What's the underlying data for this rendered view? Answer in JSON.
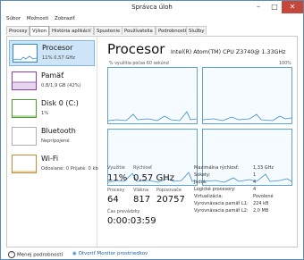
{
  "window": {
    "title": "Správca úloh"
  },
  "menu": [
    "Súbor",
    "Možnosti",
    "Zobraziť"
  ],
  "tabs": [
    "Procesy",
    "Výkon",
    "História aplikácií",
    "Spustenie",
    "Používatelia",
    "Podrobnosti",
    "Služby"
  ],
  "resources": [
    {
      "name": "Procesor",
      "detail": "11% 0,57 GHz"
    },
    {
      "name": "Pamäť",
      "detail": "0,8/1,9 GB (42%)"
    },
    {
      "name": "Disk 0 (C:)",
      "detail": "1%"
    },
    {
      "name": "Bluetooth",
      "detail": "Nepripojené"
    },
    {
      "name": "Wi-Fi",
      "detail": "Odoslané: 0 Prijaté: 0 kb"
    }
  ],
  "panel": {
    "title": "Procesor",
    "cpu_name": "Intel(R) Atom(TM) CPU Z3740@ 1.33GHz",
    "graph_label": "% využitia počas 60 sekúnd",
    "graph_max": "100%"
  },
  "stats": {
    "utilization_label": "Využitie",
    "utilization": "11%",
    "speed_label": "Rýchlosť",
    "speed": "0,57 GHz",
    "processes_label": "Procesy",
    "processes": "64",
    "threads_label": "Vlákna",
    "threads": "817",
    "handles_label": "Popisovače",
    "handles": "20757",
    "uptime_label": "Čas prevádzky",
    "uptime": "0:00:03:59"
  },
  "details": [
    {
      "k": "Maximálna rýchlosť:",
      "v": "1,33 GHz"
    },
    {
      "k": "Sokety:",
      "v": "1"
    },
    {
      "k": "Jadrá:",
      "v": "4"
    },
    {
      "k": "Logické procesory:",
      "v": "4"
    },
    {
      "k": "Virtualizácia:",
      "v": "Povolené"
    },
    {
      "k": "Vyrovnávacia pamäť L1:",
      "v": "224 kB"
    },
    {
      "k": "Vyrovnávacia pamäť L2:",
      "v": "2,0 MB"
    }
  ],
  "footer": {
    "less_details": "Menej podrobností",
    "resource_monitor": "Otvoriť Monitor prostriedkov"
  },
  "colors": {
    "graph_line": "#3a8fd0",
    "graph_bg": "#f6fbff",
    "selected": "#cde5f7",
    "close": "#c7463a"
  }
}
